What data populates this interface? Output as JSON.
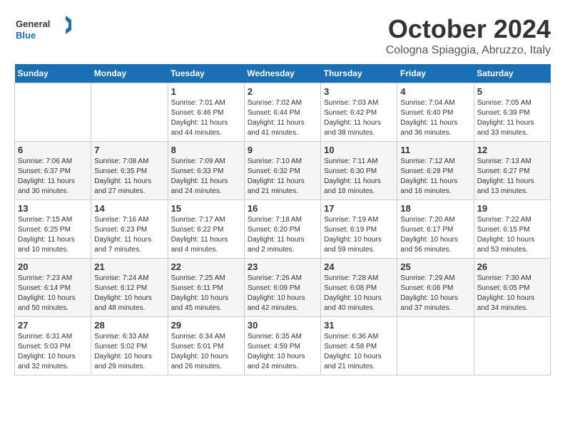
{
  "header": {
    "logo_general": "General",
    "logo_blue": "Blue",
    "month_title": "October 2024",
    "location": "Cologna Spiaggia, Abruzzo, Italy"
  },
  "weekdays": [
    "Sunday",
    "Monday",
    "Tuesday",
    "Wednesday",
    "Thursday",
    "Friday",
    "Saturday"
  ],
  "weeks": [
    [
      {
        "day": "",
        "sunrise": "",
        "sunset": "",
        "daylight": ""
      },
      {
        "day": "",
        "sunrise": "",
        "sunset": "",
        "daylight": ""
      },
      {
        "day": "1",
        "sunrise": "Sunrise: 7:01 AM",
        "sunset": "Sunset: 6:46 PM",
        "daylight": "Daylight: 11 hours and 44 minutes."
      },
      {
        "day": "2",
        "sunrise": "Sunrise: 7:02 AM",
        "sunset": "Sunset: 6:44 PM",
        "daylight": "Daylight: 11 hours and 41 minutes."
      },
      {
        "day": "3",
        "sunrise": "Sunrise: 7:03 AM",
        "sunset": "Sunset: 6:42 PM",
        "daylight": "Daylight: 11 hours and 38 minutes."
      },
      {
        "day": "4",
        "sunrise": "Sunrise: 7:04 AM",
        "sunset": "Sunset: 6:40 PM",
        "daylight": "Daylight: 11 hours and 36 minutes."
      },
      {
        "day": "5",
        "sunrise": "Sunrise: 7:05 AM",
        "sunset": "Sunset: 6:39 PM",
        "daylight": "Daylight: 11 hours and 33 minutes."
      }
    ],
    [
      {
        "day": "6",
        "sunrise": "Sunrise: 7:06 AM",
        "sunset": "Sunset: 6:37 PM",
        "daylight": "Daylight: 11 hours and 30 minutes."
      },
      {
        "day": "7",
        "sunrise": "Sunrise: 7:08 AM",
        "sunset": "Sunset: 6:35 PM",
        "daylight": "Daylight: 11 hours and 27 minutes."
      },
      {
        "day": "8",
        "sunrise": "Sunrise: 7:09 AM",
        "sunset": "Sunset: 6:33 PM",
        "daylight": "Daylight: 11 hours and 24 minutes."
      },
      {
        "day": "9",
        "sunrise": "Sunrise: 7:10 AM",
        "sunset": "Sunset: 6:32 PM",
        "daylight": "Daylight: 11 hours and 21 minutes."
      },
      {
        "day": "10",
        "sunrise": "Sunrise: 7:11 AM",
        "sunset": "Sunset: 6:30 PM",
        "daylight": "Daylight: 11 hours and 18 minutes."
      },
      {
        "day": "11",
        "sunrise": "Sunrise: 7:12 AM",
        "sunset": "Sunset: 6:28 PM",
        "daylight": "Daylight: 11 hours and 16 minutes."
      },
      {
        "day": "12",
        "sunrise": "Sunrise: 7:13 AM",
        "sunset": "Sunset: 6:27 PM",
        "daylight": "Daylight: 11 hours and 13 minutes."
      }
    ],
    [
      {
        "day": "13",
        "sunrise": "Sunrise: 7:15 AM",
        "sunset": "Sunset: 6:25 PM",
        "daylight": "Daylight: 11 hours and 10 minutes."
      },
      {
        "day": "14",
        "sunrise": "Sunrise: 7:16 AM",
        "sunset": "Sunset: 6:23 PM",
        "daylight": "Daylight: 11 hours and 7 minutes."
      },
      {
        "day": "15",
        "sunrise": "Sunrise: 7:17 AM",
        "sunset": "Sunset: 6:22 PM",
        "daylight": "Daylight: 11 hours and 4 minutes."
      },
      {
        "day": "16",
        "sunrise": "Sunrise: 7:18 AM",
        "sunset": "Sunset: 6:20 PM",
        "daylight": "Daylight: 11 hours and 2 minutes."
      },
      {
        "day": "17",
        "sunrise": "Sunrise: 7:19 AM",
        "sunset": "Sunset: 6:19 PM",
        "daylight": "Daylight: 10 hours and 59 minutes."
      },
      {
        "day": "18",
        "sunrise": "Sunrise: 7:20 AM",
        "sunset": "Sunset: 6:17 PM",
        "daylight": "Daylight: 10 hours and 56 minutes."
      },
      {
        "day": "19",
        "sunrise": "Sunrise: 7:22 AM",
        "sunset": "Sunset: 6:15 PM",
        "daylight": "Daylight: 10 hours and 53 minutes."
      }
    ],
    [
      {
        "day": "20",
        "sunrise": "Sunrise: 7:23 AM",
        "sunset": "Sunset: 6:14 PM",
        "daylight": "Daylight: 10 hours and 50 minutes."
      },
      {
        "day": "21",
        "sunrise": "Sunrise: 7:24 AM",
        "sunset": "Sunset: 6:12 PM",
        "daylight": "Daylight: 10 hours and 48 minutes."
      },
      {
        "day": "22",
        "sunrise": "Sunrise: 7:25 AM",
        "sunset": "Sunset: 6:11 PM",
        "daylight": "Daylight: 10 hours and 45 minutes."
      },
      {
        "day": "23",
        "sunrise": "Sunrise: 7:26 AM",
        "sunset": "Sunset: 6:09 PM",
        "daylight": "Daylight: 10 hours and 42 minutes."
      },
      {
        "day": "24",
        "sunrise": "Sunrise: 7:28 AM",
        "sunset": "Sunset: 6:08 PM",
        "daylight": "Daylight: 10 hours and 40 minutes."
      },
      {
        "day": "25",
        "sunrise": "Sunrise: 7:29 AM",
        "sunset": "Sunset: 6:06 PM",
        "daylight": "Daylight: 10 hours and 37 minutes."
      },
      {
        "day": "26",
        "sunrise": "Sunrise: 7:30 AM",
        "sunset": "Sunset: 6:05 PM",
        "daylight": "Daylight: 10 hours and 34 minutes."
      }
    ],
    [
      {
        "day": "27",
        "sunrise": "Sunrise: 6:31 AM",
        "sunset": "Sunset: 5:03 PM",
        "daylight": "Daylight: 10 hours and 32 minutes."
      },
      {
        "day": "28",
        "sunrise": "Sunrise: 6:33 AM",
        "sunset": "Sunset: 5:02 PM",
        "daylight": "Daylight: 10 hours and 29 minutes."
      },
      {
        "day": "29",
        "sunrise": "Sunrise: 6:34 AM",
        "sunset": "Sunset: 5:01 PM",
        "daylight": "Daylight: 10 hours and 26 minutes."
      },
      {
        "day": "30",
        "sunrise": "Sunrise: 6:35 AM",
        "sunset": "Sunset: 4:59 PM",
        "daylight": "Daylight: 10 hours and 24 minutes."
      },
      {
        "day": "31",
        "sunrise": "Sunrise: 6:36 AM",
        "sunset": "Sunset: 4:58 PM",
        "daylight": "Daylight: 10 hours and 21 minutes."
      },
      {
        "day": "",
        "sunrise": "",
        "sunset": "",
        "daylight": ""
      },
      {
        "day": "",
        "sunrise": "",
        "sunset": "",
        "daylight": ""
      }
    ]
  ]
}
